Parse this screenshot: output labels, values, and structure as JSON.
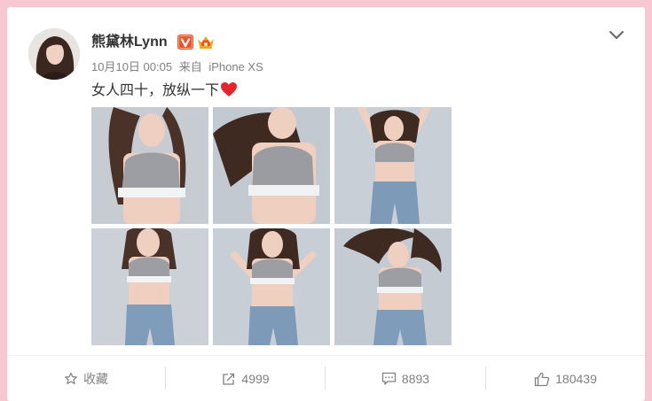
{
  "post": {
    "username": "熊黛林Lynn",
    "timestamp": "10月10日 00:05",
    "source_prefix": "来自",
    "source": "iPhone XS",
    "text": "女人四十，放纵一下",
    "photos": [
      {
        "label": "photo-1"
      },
      {
        "label": "photo-2"
      },
      {
        "label": "photo-3"
      },
      {
        "label": "photo-4"
      },
      {
        "label": "photo-5"
      },
      {
        "label": "photo-6"
      }
    ]
  },
  "actions": {
    "favorite_label": "收藏",
    "repost_count": "4999",
    "comment_count": "8893",
    "like_count": "180439"
  },
  "colors": {
    "page_bg": "#f7c8d2",
    "card_bg": "#ffffff",
    "verified_badge": "#e8542b",
    "heart": "#e3262c",
    "muted_text": "#808080"
  },
  "icons": [
    "verified-v-icon",
    "crown-badge-icon",
    "chevron-down-icon",
    "heart-icon",
    "star-icon",
    "repost-icon",
    "comment-icon",
    "like-icon"
  ]
}
